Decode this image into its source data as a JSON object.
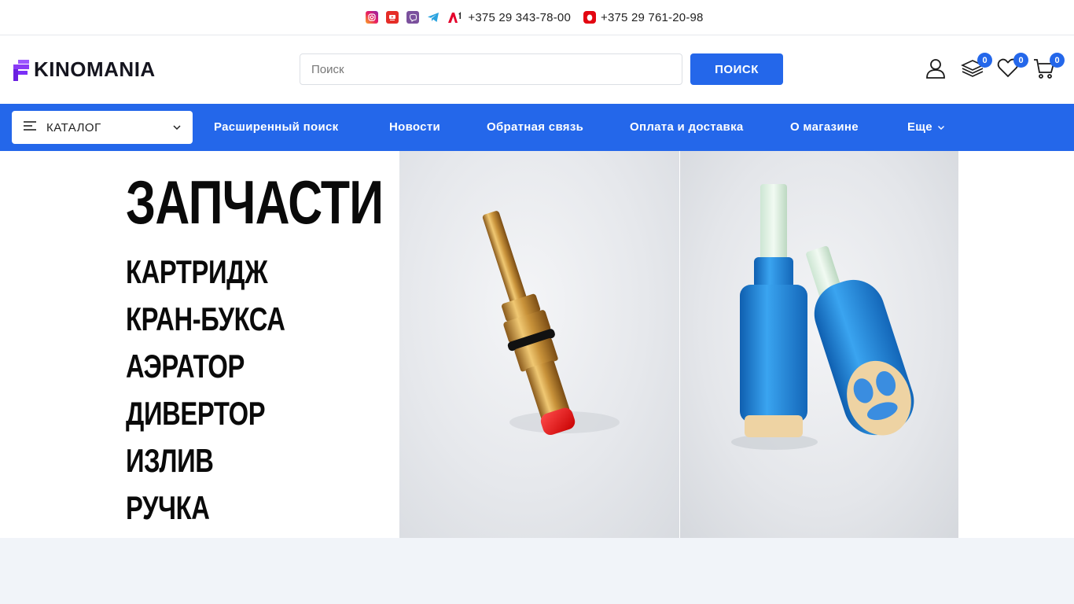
{
  "topbar": {
    "phone1": "+375 29 343-78-00",
    "phone2": "+375 29 761-20-98",
    "icons": [
      "instagram-icon",
      "youtube-icon",
      "viber-icon",
      "telegram-icon",
      "a1-icon",
      "mts-icon"
    ]
  },
  "header": {
    "logo_text": "KINOMANIA",
    "search_placeholder": "Поиск",
    "search_button": "ПОИСК",
    "compare_count": "0",
    "favorites_count": "0",
    "cart_count": "0"
  },
  "nav": {
    "catalog_label": "КАТАЛОГ",
    "links": [
      "Расширенный поиск",
      "Новости",
      "Обратная связь",
      "Оплата и доставка",
      "О магазине",
      "Еще"
    ]
  },
  "banner": {
    "title": "ЗАПЧАСТИ",
    "items": [
      "КАРТРИДЖ",
      "КРАН-БУКСА",
      "АЭРАТОР",
      "ДИВЕРТОР",
      "ИЗЛИВ",
      "РУЧКА"
    ]
  },
  "colors": {
    "accent": "#2467ea",
    "logo_purple": "#7b2ff7"
  }
}
